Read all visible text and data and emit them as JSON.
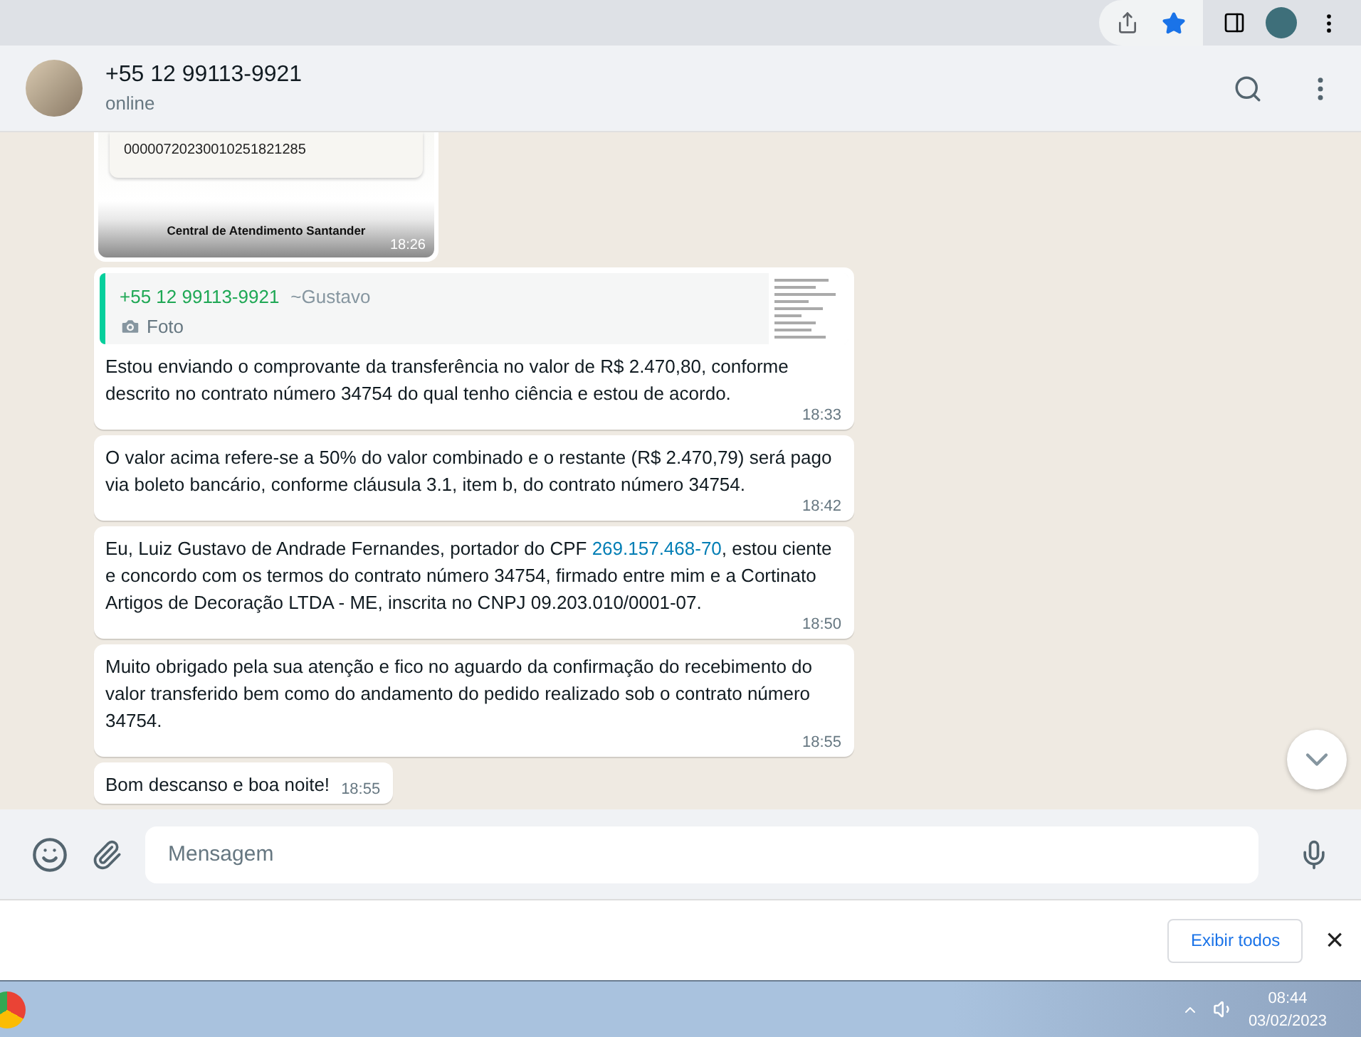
{
  "contact": {
    "name": "+55 12 99113-9921",
    "status": "online"
  },
  "image_message": {
    "code": "00000720230010251821285",
    "caption": "Central de Atendimento Santander",
    "time": "18:26"
  },
  "messages": [
    {
      "quote": {
        "author": "+55 12 99113-9921",
        "nick": "~Gustavo",
        "type": "Foto"
      },
      "parts": [
        {
          "kind": "plain",
          "text": "Estou enviando o comprovante da transferência no valor de R$ 2.470,80, conforme descrito no contrato número 34754 do qual tenho ciência e estou de acordo."
        }
      ],
      "time": "18:33"
    },
    {
      "parts": [
        {
          "kind": "plain",
          "text": "O valor acima refere-se a 50% do valor combinado e o restante (R$ 2.470,79) será pago via boleto bancário,  conforme cláusula 3.1, item b, do contrato número 34754."
        }
      ],
      "time": "18:42"
    },
    {
      "parts": [
        {
          "kind": "plain",
          "text": "Eu, Luiz Gustavo de Andrade Fernandes, portador do CPF "
        },
        {
          "kind": "link",
          "text": "269.157.468-70"
        },
        {
          "kind": "plain",
          "text": ", estou ciente e concordo com os termos do contrato número 34754, firmado entre mim e a Cortinato Artigos de Decoração LTDA - ME, inscrita no CNPJ 09.203.010/0001-07."
        }
      ],
      "time": "18:50"
    },
    {
      "parts": [
        {
          "kind": "plain",
          "text": "Muito obrigado pela sua atenção e fico no aguardo da confirmação do recebimento do valor transferido bem como do andamento do pedido realizado sob o contrato número 34754."
        }
      ],
      "time": "18:55"
    },
    {
      "parts": [
        {
          "kind": "plain",
          "text": "Bom descanso e boa noite!"
        }
      ],
      "time": "18:55"
    }
  ],
  "composer": {
    "placeholder": "Mensagem"
  },
  "download_bar": {
    "button": "Exibir todos",
    "close": "×"
  },
  "taskbar": {
    "time": "08:44",
    "date": "03/02/2023"
  }
}
